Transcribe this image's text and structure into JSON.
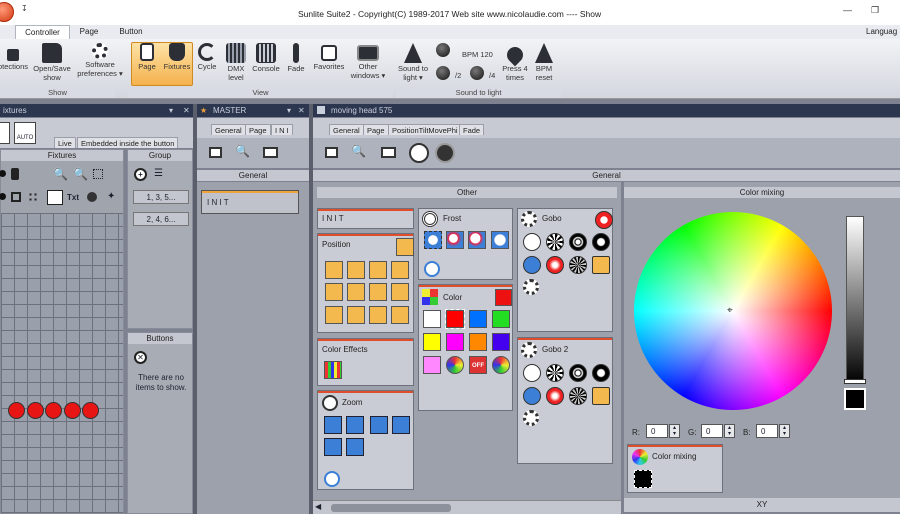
{
  "window": {
    "title": "Sunlite Suite2 - Copyright(C) 1989-2017    Web site www.nicolaudie.com ---- Show",
    "language_label": "Languag"
  },
  "tabs": [
    "Controller",
    "Page",
    "Button"
  ],
  "ribbon": {
    "show_buttons": [
      "otections",
      "Open/Save show",
      "Software preferences ▾"
    ],
    "view_buttons": [
      "Page",
      "Fixtures",
      "Cycle",
      "DMX level",
      "Console",
      "Fade",
      "Favorites",
      "Other windows ▾"
    ],
    "sound_buttons": {
      "sound_to_light": "Sound to light ▾",
      "div2": "/2",
      "bpm": "BPM 120",
      "div4": "/4",
      "press4": "Press 4 times",
      "bpm_reset": "BPM reset"
    },
    "groups": [
      "Show",
      "View",
      "Sound to light"
    ]
  },
  "fixtures_panel": {
    "title": "ixtures",
    "auto": "AUTO",
    "tabs": [
      "Live",
      "Embedded inside the button"
    ],
    "col_fixtures": "Fixtures",
    "col_group": "Group",
    "group_items": [
      "1, 3, 5...",
      "2, 4, 6..."
    ],
    "txt_label": "Txt",
    "buttons_title": "Buttons",
    "no_items": "There are no items to show."
  },
  "master_panel": {
    "title": "MASTER",
    "tabs": [
      "General",
      "Page",
      "I N I T"
    ],
    "section": "General",
    "init": "I N I T"
  },
  "moving_panel": {
    "title": "moving head 575",
    "tabs": [
      "General",
      "Page",
      "PositionTiltMovePhi",
      "Fade"
    ],
    "section": "General",
    "other": "Other",
    "color_mixing": "Color mixing",
    "xy": "XY",
    "boxes": {
      "init": "I N I T",
      "position": "Position",
      "color_effects": "Color Effects",
      "zoom": "Zoom",
      "frost": "Frost",
      "color": "Color",
      "gobo": "Gobo",
      "gobo2": "Gobo 2"
    },
    "off_label": "OFF",
    "rgb": {
      "r_label": "R:",
      "r": "0",
      "g_label": "G:",
      "g": "0",
      "b_label": "B:",
      "b": "0"
    },
    "color_mixing_btn": "Color mixing"
  },
  "colors": {
    "accent": "#e04c2c",
    "dark": "#2d364f",
    "panel": "#aeb2bc"
  }
}
